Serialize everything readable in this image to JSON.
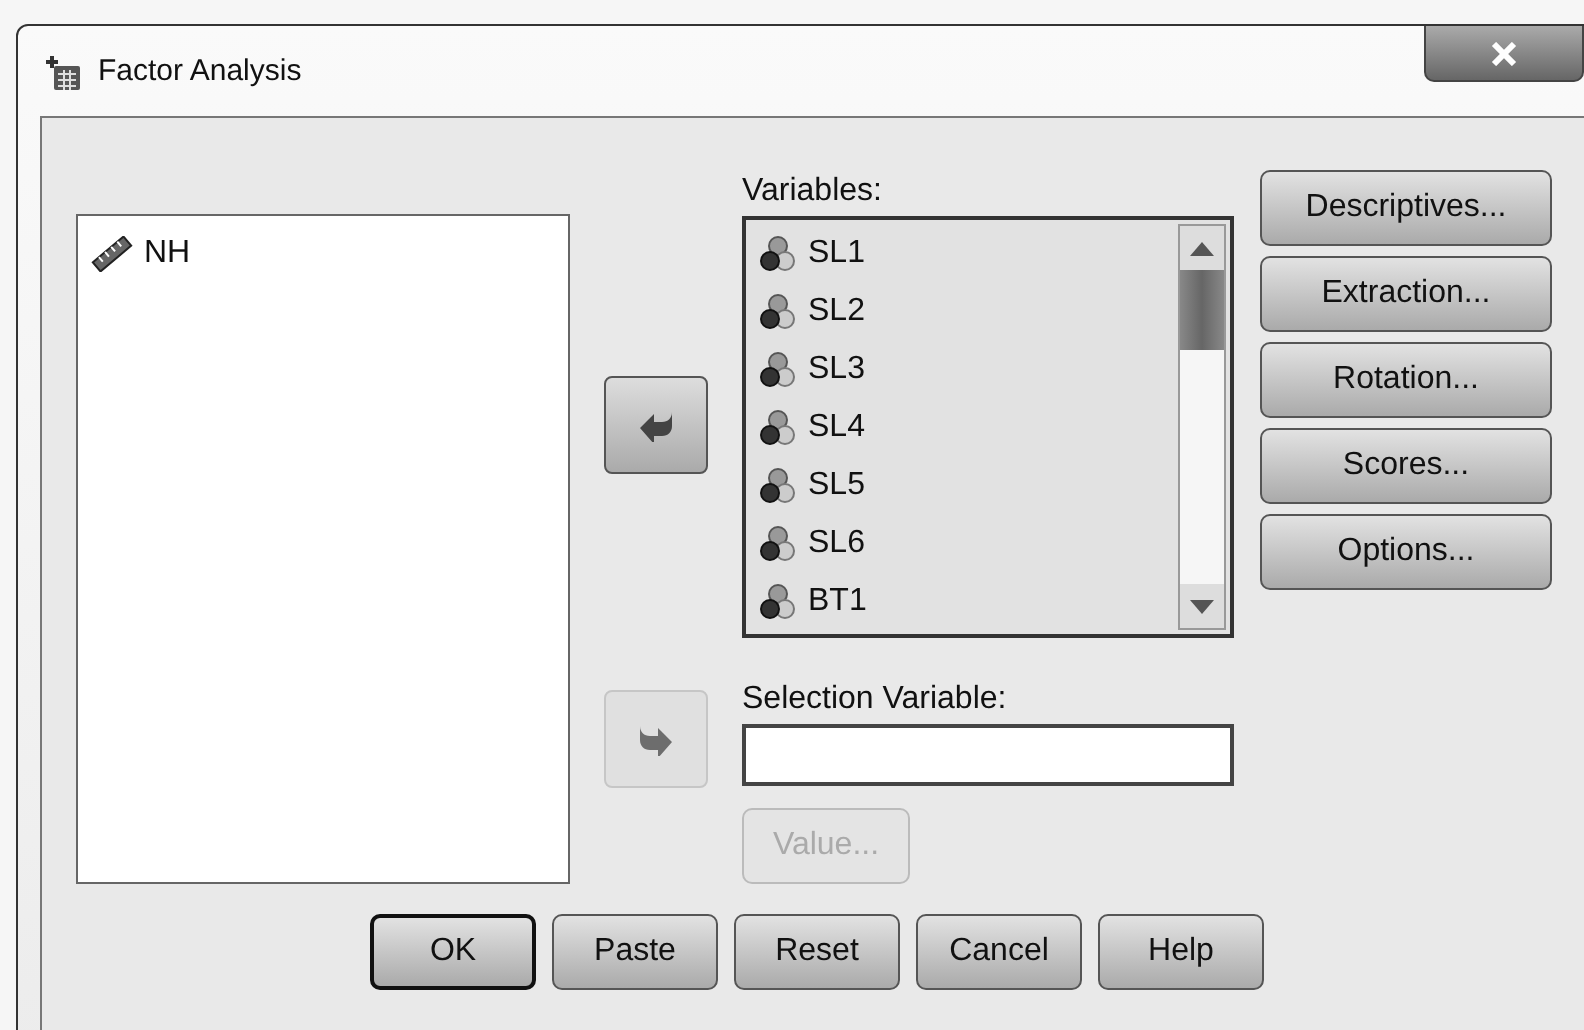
{
  "window": {
    "title": "Factor Analysis"
  },
  "source_list": {
    "items": [
      {
        "name": "NH",
        "kind": "scale"
      }
    ]
  },
  "move_buttons": [
    {
      "kind": "left",
      "disabled": false
    },
    {
      "kind": "right",
      "disabled": true
    }
  ],
  "variables": {
    "label": "Variables:",
    "items": [
      {
        "name": "SL1",
        "kind": "nominal"
      },
      {
        "name": "SL2",
        "kind": "nominal"
      },
      {
        "name": "SL3",
        "kind": "nominal"
      },
      {
        "name": "SL4",
        "kind": "nominal"
      },
      {
        "name": "SL5",
        "kind": "nominal"
      },
      {
        "name": "SL6",
        "kind": "nominal"
      },
      {
        "name": "BT1",
        "kind": "nominal"
      }
    ]
  },
  "side_buttons": [
    "Descriptives...",
    "Extraction...",
    "Rotation...",
    "Scores...",
    "Options..."
  ],
  "selection": {
    "label": "Selection Variable:",
    "value_button": {
      "label": "Value...",
      "disabled": true
    }
  },
  "buttons": [
    {
      "label": "OK",
      "default": true
    },
    {
      "label": "Paste",
      "default": false
    },
    {
      "label": "Reset",
      "default": false
    },
    {
      "label": "Cancel",
      "default": false
    },
    {
      "label": "Help",
      "default": false
    }
  ]
}
